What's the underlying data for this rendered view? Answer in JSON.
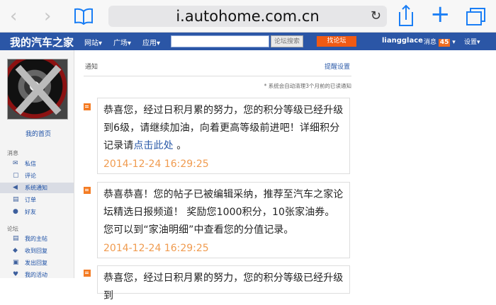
{
  "browser": {
    "url": "i.autohome.com.cn"
  },
  "nav": {
    "logo": "我的汽车之家",
    "items": [
      "网站▾",
      "广场▾",
      "应用▾"
    ],
    "forum_search": "论坛搜索",
    "find_forum": "找论坛",
    "username": "liangglace",
    "message": "消息",
    "message_count": "45",
    "settings": "设置▾"
  },
  "sidebar": {
    "home": "我的首页",
    "section_message": "消息",
    "message_items": [
      "私信",
      "评论",
      "系统通知",
      "订单",
      "好友"
    ],
    "section_forum": "论坛",
    "forum_items": [
      "我的主帖",
      "收到回复",
      "发出回复",
      "我的活动"
    ]
  },
  "content": {
    "title": "通知",
    "remind_settings": "提醒设置",
    "auto_note": "* 系统会自动清理3个月前的已读通知",
    "notifications": [
      {
        "text_before": "恭喜您，经过日积月累的努力，您的积分等级已经升级到6级，请继续加油，向着更高等级前进吧！详细积分记录请",
        "link": "点击此处",
        "text_after": "。",
        "date": "2014-12-24 16:29:25"
      },
      {
        "text": "恭喜恭喜！您的帖子已被编辑采纳，推荐至汽车之家论坛精选日报频道！ 奖励您1000积分，10张家油券。您可以到“家油明细”中查看您的分值记录。",
        "date": "2014-12-24 16:29:25"
      },
      {
        "text": "恭喜您，经过日积月累的努力，您的积分等级已经升级到"
      }
    ]
  },
  "colors": {
    "nav": "#2b56a6",
    "orange": "#f05a14",
    "date": "#f09b4f",
    "link": "#2b5aa8"
  }
}
